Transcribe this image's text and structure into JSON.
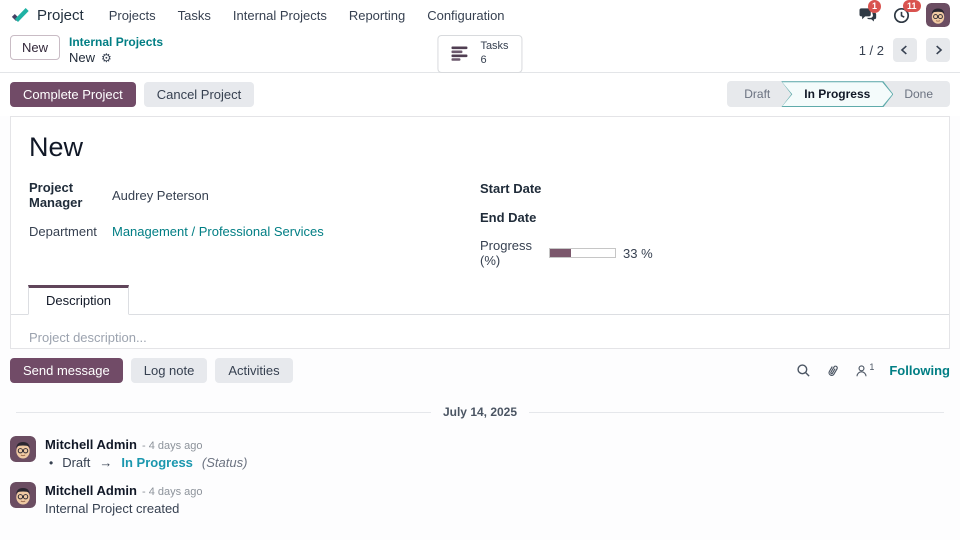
{
  "colors": {
    "accent_purple": "#714B67",
    "link_teal": "#017e84",
    "badge_red": "#d9534f",
    "tracking_new_value": "#1a97ae",
    "progress_fill": "#7b576c",
    "stage_active_border": "#5fabab"
  },
  "icons": {
    "gear": "⚙"
  },
  "nav": {
    "app_name": "Project",
    "items": [
      "Projects",
      "Tasks",
      "Internal Projects",
      "Reporting",
      "Configuration"
    ],
    "messages_badge": "1",
    "activities_badge": "11"
  },
  "control_panel": {
    "new_button": "New",
    "breadcrumb_parent": "Internal Projects",
    "breadcrumb_current": "New",
    "smart_button": {
      "label": "Tasks",
      "count": "6"
    },
    "pager": "1 / 2"
  },
  "statusbar": {
    "complete_button": "Complete Project",
    "cancel_button": "Cancel Project",
    "stages": [
      {
        "label": "Draft"
      },
      {
        "label": "In Progress"
      },
      {
        "label": "Done"
      }
    ],
    "active_stage": "In Progress"
  },
  "form": {
    "title": "New",
    "project_manager_label": "Project Manager",
    "project_manager_value": "Audrey Peterson",
    "department_label": "Department",
    "department_value": "Management / Professional Services",
    "start_date_label": "Start Date",
    "start_date_value": "",
    "end_date_label": "End Date",
    "end_date_value": "",
    "progress_label": "Progress (%)",
    "progress_percent": 33,
    "progress_display": "33 %",
    "tab_description": "Description",
    "description_placeholder": "Project description..."
  },
  "chatter": {
    "send_message": "Send message",
    "log_note": "Log note",
    "activities": "Activities",
    "followers_count": "1",
    "following": "Following",
    "date_separator": "July 14, 2025",
    "messages": [
      {
        "author": "Mitchell Admin",
        "time": "- 4 days ago",
        "bullet": "•",
        "old_value": "Draft",
        "arrow": "→",
        "new_value": "In Progress",
        "field_note": "(Status)"
      },
      {
        "author": "Mitchell Admin",
        "time": "- 4 days ago",
        "body": "Internal Project created"
      }
    ]
  }
}
